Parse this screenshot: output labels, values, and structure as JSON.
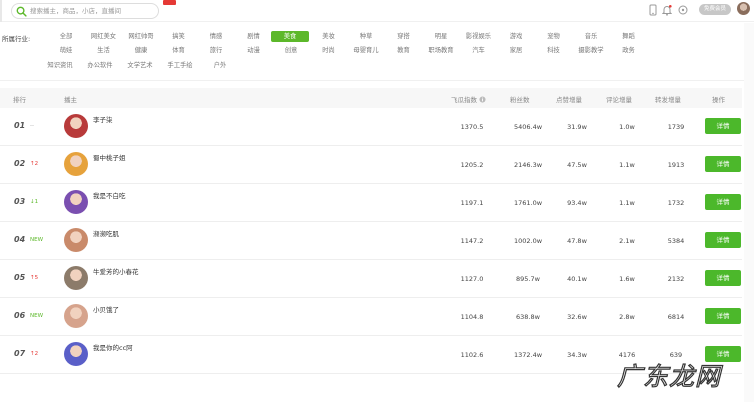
{
  "header": {
    "search_placeholder": "搜索播主，商品，小店，直播间",
    "member_label": "免费会员"
  },
  "industry": {
    "label": "所属行业:",
    "active_index": 10,
    "tags_row1": [
      "全部",
      "网红美女",
      "网红帅哥",
      "搞笑",
      "情感",
      "剧情",
      "美食",
      "美妆",
      "种草",
      "穿搭",
      "明星",
      "影视娱乐",
      "游戏",
      "宠物",
      "音乐",
      "舞蹈"
    ],
    "tags_row2": [
      "萌娃",
      "生活",
      "健康",
      "体育",
      "旅行",
      "动漫",
      "创意",
      "时尚",
      "母婴育儿",
      "教育",
      "职场教育",
      "汽车",
      "家居",
      "科技",
      "摄影教学",
      "政务"
    ],
    "tags_row3": [
      "知识资讯",
      "办公软件",
      "文学艺术",
      "手工手绘",
      "户外"
    ]
  },
  "table": {
    "headers": {
      "rank": "排行",
      "host": "播主",
      "index": "飞瓜指数",
      "fans": "粉丝数",
      "likes_inc": "点赞增量",
      "comments_inc": "评论增量",
      "shares_inc": "转发增量",
      "action": "操作"
    },
    "detail_label": "详情",
    "rows": [
      {
        "rank": "01",
        "change": "--",
        "change_type": "flat",
        "name": "李子柒",
        "index": "1370.5",
        "fans": "5406.4w",
        "likes": "31.9w",
        "comments": "1.0w",
        "shares": "1739",
        "avatar": "#b83a3a"
      },
      {
        "rank": "02",
        "change": "↑2",
        "change_type": "up",
        "name": "蜀中桃子姐",
        "index": "1205.2",
        "fans": "2146.3w",
        "likes": "47.5w",
        "comments": "1.1w",
        "shares": "1913",
        "avatar": "#e6a23c"
      },
      {
        "rank": "03",
        "change": "↓1",
        "change_type": "down",
        "name": "我是不白吃",
        "index": "1197.1",
        "fans": "1761.0w",
        "likes": "93.4w",
        "comments": "1.1w",
        "shares": "1732",
        "avatar": "#7a4fb0"
      },
      {
        "rank": "04",
        "change": "NEW",
        "change_type": "new",
        "name": "濒濒吃肌",
        "index": "1147.2",
        "fans": "1002.0w",
        "likes": "47.8w",
        "comments": "2.1w",
        "shares": "5384",
        "avatar": "#c98a6a"
      },
      {
        "rank": "05",
        "change": "↑5",
        "change_type": "up",
        "name": "牛爱芳的小春花",
        "index": "1127.0",
        "fans": "895.7w",
        "likes": "40.1w",
        "comments": "1.6w",
        "shares": "2132",
        "avatar": "#8c7b6a"
      },
      {
        "rank": "06",
        "change": "NEW",
        "change_type": "new",
        "name": "小贝饿了",
        "index": "1104.8",
        "fans": "638.8w",
        "likes": "32.6w",
        "comments": "2.8w",
        "shares": "6814",
        "avatar": "#d6a38c"
      },
      {
        "rank": "07",
        "change": "↑2",
        "change_type": "up",
        "name": "我是你的cc阿",
        "index": "1102.6",
        "fans": "1372.4w",
        "likes": "34.3w",
        "comments": "4176",
        "shares": "639",
        "avatar": "#5a5fc8"
      }
    ]
  },
  "watermark": "广东龙网"
}
